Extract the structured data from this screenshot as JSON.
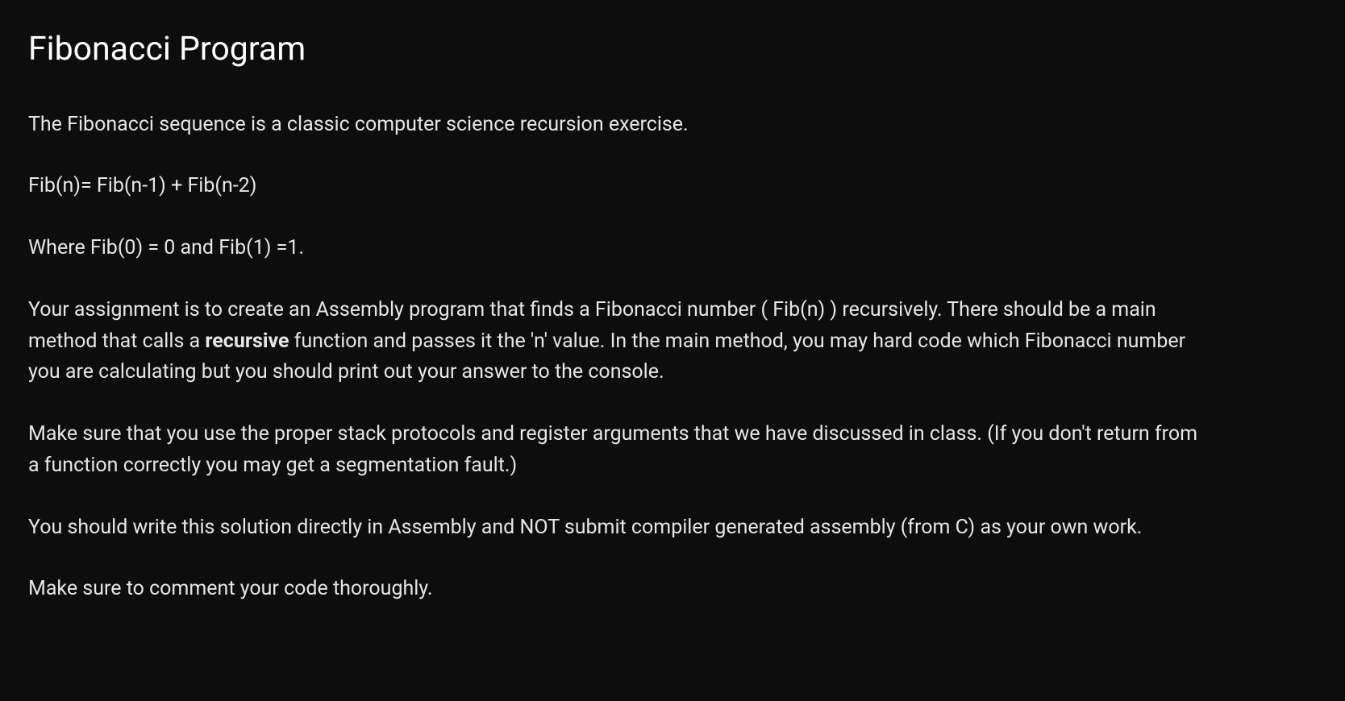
{
  "title": "Fibonacci Program",
  "paragraphs": {
    "intro": "The Fibonacci sequence is a classic computer science recursion exercise.",
    "formula": "Fib(n)= Fib(n-1) + Fib(n-2)",
    "base_cases": "Where Fib(0) = 0 and Fib(1) =1.",
    "assignment_part1": "Your assignment is to create an Assembly program that finds a Fibonacci number ( Fib(n) ) recursively. There should be a main method that calls a ",
    "assignment_bold": "recursive",
    "assignment_part2": " function and passes it the 'n' value. In the main method, you may hard code which Fibonacci number you are calculating but you should print out your answer to the console.",
    "stack_protocols": "Make sure that you use the proper stack protocols and register arguments that we have discussed in class. (If you don't return from a function correctly you may get a segmentation fault.)",
    "direct_assembly": "You should write this solution directly in Assembly and NOT submit compiler generated assembly (from C) as your own work.",
    "comments": "Make sure to comment your code thoroughly."
  }
}
